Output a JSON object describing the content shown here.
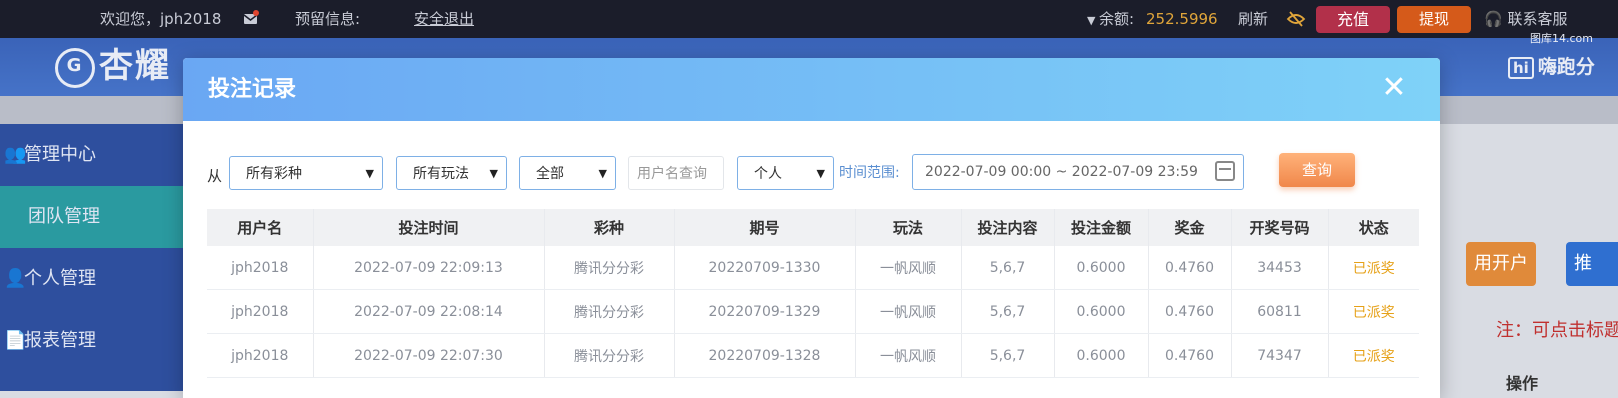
{
  "topbar": {
    "welcome": "欢迎您，jph2018",
    "reserve_label": "预留信息:",
    "logout": "安全退出",
    "balance_label": "余额:",
    "balance_value": "252.5996",
    "refresh": "刷新",
    "recharge": "充值",
    "withdraw": "提现",
    "service": "联系客服"
  },
  "nav": {
    "logo_text": "杏耀",
    "partner": "嗨跑分",
    "watermark": "图库14.com"
  },
  "sidebar": {
    "items": [
      {
        "label": "管理中心"
      },
      {
        "label": "团队管理"
      },
      {
        "label": "个人管理"
      },
      {
        "label": "报表管理"
      }
    ]
  },
  "background_right": {
    "button1": "用开户",
    "button2": "推",
    "note": "注：可点击标题",
    "ops": "操作"
  },
  "modal": {
    "title": "投注记录",
    "close": "✕",
    "filters": {
      "from_label": "从",
      "lottery": "所有彩种",
      "play": "所有玩法",
      "status": "全部",
      "username_placeholder": "用户名查询",
      "scope": "个人",
      "range_label": "时间范围:",
      "range_value": "2022-07-09 00:00 ~ 2022-07-09 23:59",
      "query": "查询"
    },
    "table": {
      "headers": [
        "用户名",
        "投注时间",
        "彩种",
        "期号",
        "玩法",
        "投注内容",
        "投注金额",
        "奖金",
        "开奖号码",
        "状态"
      ],
      "rows": [
        [
          "jph2018",
          "2022-07-09 22:09:13",
          "腾讯分分彩",
          "20220709-1330",
          "一帆风顺",
          "5,6,7",
          "0.6000",
          "0.4760",
          "34453",
          "已派奖"
        ],
        [
          "jph2018",
          "2022-07-09 22:08:14",
          "腾讯分分彩",
          "20220709-1329",
          "一帆风顺",
          "5,6,7",
          "0.6000",
          "0.4760",
          "60811",
          "已派奖"
        ],
        [
          "jph2018",
          "2022-07-09 22:07:30",
          "腾讯分分彩",
          "20220709-1328",
          "一帆风顺",
          "5,6,7",
          "0.6000",
          "0.4760",
          "74347",
          "已派奖"
        ]
      ]
    }
  }
}
